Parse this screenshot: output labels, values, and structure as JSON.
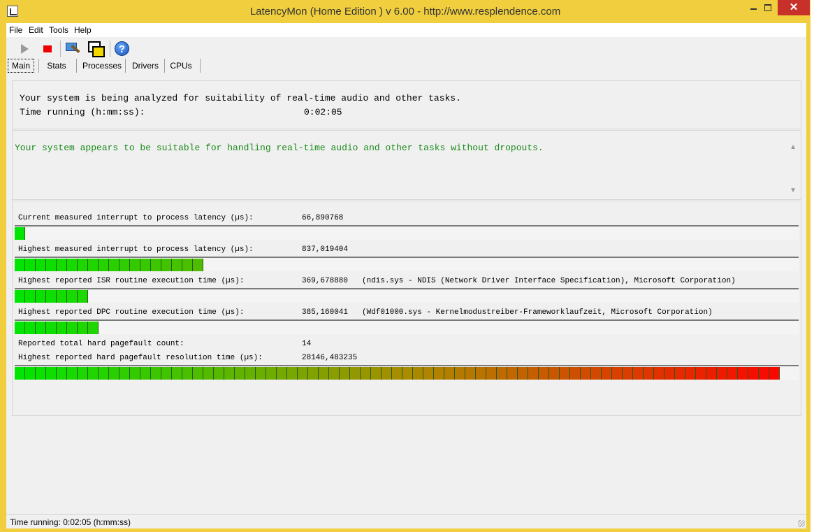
{
  "window": {
    "title": "LatencyMon  (Home Edition )  v 6.00 - http://www.resplendence.com"
  },
  "menu": [
    {
      "label": "File"
    },
    {
      "label": "Edit"
    },
    {
      "label": "Tools"
    },
    {
      "label": "Help"
    }
  ],
  "toolbar": {
    "play": "play-icon",
    "stop": "stop-icon",
    "hammer": "hammer-icon",
    "windows": "windows-icon",
    "help": "help-icon"
  },
  "tabs": [
    {
      "label": "Main",
      "active": true
    },
    {
      "label": "Stats"
    },
    {
      "label": "Processes"
    },
    {
      "label": "Drivers"
    },
    {
      "label": "CPUs"
    }
  ],
  "summary": {
    "analyzing": "Your system is being analyzed for suitability of real-time audio and other tasks.",
    "time_label": "Time running (h:mm:ss):",
    "time_value": "0:02:05"
  },
  "verdict": "Your system appears to be suitable for handling real-time audio and other tasks without dropouts.",
  "metrics": {
    "current_latency": {
      "label": "Current measured interrupt to process latency (µs):",
      "value": "66,890768",
      "level": 0.012
    },
    "highest_latency": {
      "label": "Highest measured interrupt to process latency (µs):",
      "value": "837,019404",
      "level": 0.24
    },
    "isr": {
      "label": "Highest reported ISR routine execution time (µs):",
      "value": "369,678880",
      "extra": "(ndis.sys - NDIS (Network Driver Interface Specification), Microsoft Corporation)",
      "level": 0.095
    },
    "dpc": {
      "label": "Highest reported DPC routine execution time (µs):",
      "value": "385,160041",
      "extra": "(Wdf01000.sys - Kernelmodustreiber-Frameworklaufzeit, Microsoft Corporation)",
      "level": 0.11
    },
    "pagefault_count": {
      "label": "Reported total hard pagefault count:",
      "value": "14"
    },
    "pagefault_time": {
      "label": "Highest reported hard pagefault resolution time (µs):",
      "value": "28146,483235",
      "level": 0.985
    }
  },
  "status": "Time running: 0:02:05  (h:mm:ss)",
  "colors": {
    "title_bar": "#f0ce3e",
    "close_button": "#c7312a",
    "verdict_text": "#1a8a1a",
    "bar_low": "#00ff00",
    "bar_high": "#ff0000"
  }
}
